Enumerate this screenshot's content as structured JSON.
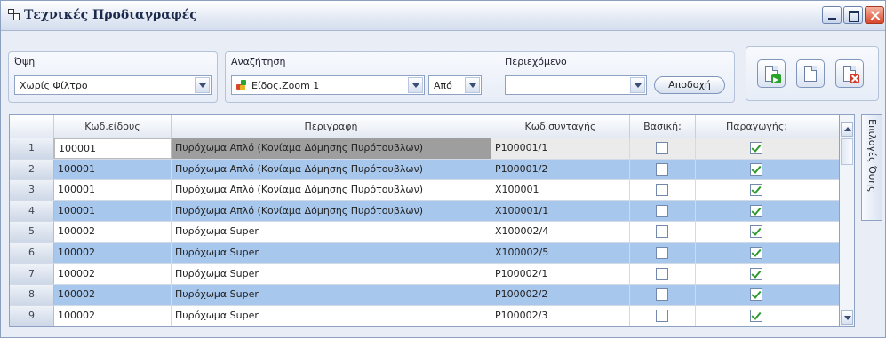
{
  "window": {
    "title": "Τεχνικές Προδιαγραφές"
  },
  "filters": {
    "view_label": "Όψη",
    "view_value": "Χωρίς Φίλτρο",
    "search_label": "Αναζήτηση",
    "search_value": "Είδος.Zoom 1",
    "search_op": "Από",
    "content_label": "Περιεχόμενο",
    "content_value": "",
    "accept_label": "Αποδοχή"
  },
  "toolbar": {
    "icons": [
      "new-doc-green-icon",
      "blank-doc-icon",
      "delete-doc-red-icon"
    ]
  },
  "grid": {
    "columns": [
      "Κωδ.είδους",
      "Περιγραφή",
      "Κωδ.συνταγής",
      "Βασική;",
      "Παραγωγής;"
    ],
    "rows": [
      {
        "num": "1",
        "code": "100001",
        "desc": "Πυρόχωμα Απλό (Κονίαμα Δόμησης Πυρότουβλων)",
        "recipe": "P100001/1",
        "basic": false,
        "production": true
      },
      {
        "num": "2",
        "code": "100001",
        "desc": "Πυρόχωμα Απλό (Κονίαμα Δόμησης Πυρότουβλων)",
        "recipe": "P100001/2",
        "basic": false,
        "production": true
      },
      {
        "num": "3",
        "code": "100001",
        "desc": "Πυρόχωμα Απλό (Κονίαμα Δόμησης Πυρότουβλων)",
        "recipe": "X100001",
        "basic": false,
        "production": true
      },
      {
        "num": "4",
        "code": "100001",
        "desc": "Πυρόχωμα Απλό (Κονίαμα Δόμησης Πυρότουβλων)",
        "recipe": "X100001/1",
        "basic": false,
        "production": true
      },
      {
        "num": "5",
        "code": "100002",
        "desc": "Πυρόχωμα Super",
        "recipe": "X100002/4",
        "basic": false,
        "production": true
      },
      {
        "num": "6",
        "code": "100002",
        "desc": "Πυρόχωμα Super",
        "recipe": "X100002/5",
        "basic": false,
        "production": true
      },
      {
        "num": "7",
        "code": "100002",
        "desc": "Πυρόχωμα Super",
        "recipe": "P100002/1",
        "basic": false,
        "production": true
      },
      {
        "num": "8",
        "code": "100002",
        "desc": "Πυρόχωμα Super",
        "recipe": "P100002/2",
        "basic": false,
        "production": true
      },
      {
        "num": "9",
        "code": "100002",
        "desc": "Πυρόχωμα Super",
        "recipe": "P100002/3",
        "basic": false,
        "production": true
      }
    ]
  },
  "sidetab": {
    "label": "Επιλογές Όψης"
  },
  "colors": {
    "alt_row": "#a8c7ec",
    "selected_row": "#ebebeb",
    "check": "#2e9a2e"
  }
}
